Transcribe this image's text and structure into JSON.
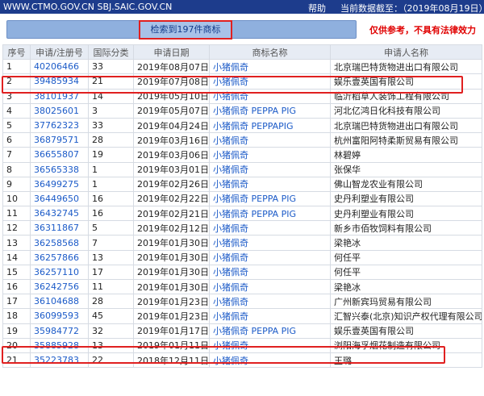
{
  "header": {
    "site": "WWW.CTMO.GOV.CN SBJ.SAIC.GOV.CN",
    "help": "帮助",
    "data_as_of": "当前数据截至：（2019年08月19日）"
  },
  "search": {
    "result_label": "检索到197件商标",
    "disclaimer": "仅供参考，不具有法律效力"
  },
  "table": {
    "headers": [
      "序号",
      "申请/注册号",
      "国际分类",
      "申请日期",
      "商标名称",
      "申请人名称"
    ],
    "rows": [
      [
        "1",
        "40206466",
        "33",
        "2019年08月07日",
        "小猪佩奇",
        "北京瑞巴特货物进出口有限公司"
      ],
      [
        "2",
        "39485934",
        "21",
        "2019年07月08日",
        "小猪佩奇",
        "娱乐壹英国有限公司"
      ],
      [
        "3",
        "38101937",
        "14",
        "2019年05月10日",
        "小猪佩奇",
        "临沂稻草人装饰工程有限公司"
      ],
      [
        "4",
        "38025601",
        "3",
        "2019年05月07日",
        "小猪佩奇 PEPPA PIG",
        "河北亿鸿日化科技有限公司"
      ],
      [
        "5",
        "37762323",
        "33",
        "2019年04月24日",
        "小猪佩奇 PEPPAPIG",
        "北京瑞巴特货物进出口有限公司"
      ],
      [
        "6",
        "36879571",
        "28",
        "2019年03月16日",
        "小猪佩奇",
        "杭州富阳阿特柔斯贸易有限公司"
      ],
      [
        "7",
        "36655807",
        "19",
        "2019年03月06日",
        "小猪佩奇",
        "林碧婷"
      ],
      [
        "8",
        "36565338",
        "1",
        "2019年03月01日",
        "小猪佩奇",
        "张保华"
      ],
      [
        "9",
        "36499275",
        "1",
        "2019年02月26日",
        "小猪佩奇",
        "佛山智龙农业有限公司"
      ],
      [
        "10",
        "36449650",
        "16",
        "2019年02月22日",
        "小猪佩奇 PEPPA PIG",
        "史丹利塑业有限公司"
      ],
      [
        "11",
        "36432745",
        "16",
        "2019年02月21日",
        "小猪佩奇 PEPPA PIG",
        "史丹利塑业有限公司"
      ],
      [
        "12",
        "36311867",
        "5",
        "2019年02月12日",
        "小猪佩奇",
        "新乡市佰牧饲料有限公司"
      ],
      [
        "13",
        "36258568",
        "7",
        "2019年01月30日",
        "小猪佩奇",
        "梁艳冰"
      ],
      [
        "14",
        "36257866",
        "13",
        "2019年01月30日",
        "小猪佩奇",
        "何任平"
      ],
      [
        "15",
        "36257110",
        "17",
        "2019年01月30日",
        "小猪佩奇",
        "何任平"
      ],
      [
        "16",
        "36242756",
        "11",
        "2019年01月30日",
        "小猪佩奇",
        "梁艳冰"
      ],
      [
        "17",
        "36104688",
        "28",
        "2019年01月23日",
        "小猪佩奇",
        "广州新宾玛贸易有限公司"
      ],
      [
        "18",
        "36099593",
        "45",
        "2019年01月23日",
        "小猪佩奇",
        "汇智兴泰(北京)知识产权代理有限公司"
      ],
      [
        "19",
        "35984772",
        "32",
        "2019年01月17日",
        "小猪佩奇 PEPPA PIG",
        "娱乐壹英国有限公司"
      ],
      [
        "20",
        "35885928",
        "13",
        "2019年01月11日",
        "小猪佩奇",
        "浏阳海孚烟花制造有限公司"
      ],
      [
        "21",
        "35223783",
        "22",
        "2018年12月11日",
        "小猪佩奇",
        "王璐"
      ]
    ]
  },
  "colors": {
    "topbar": "#1d3c8c",
    "search_bar": "#8fb0de",
    "highlight": "#e02020",
    "link": "#1c5bc8",
    "disclaimer": "#e00000"
  }
}
